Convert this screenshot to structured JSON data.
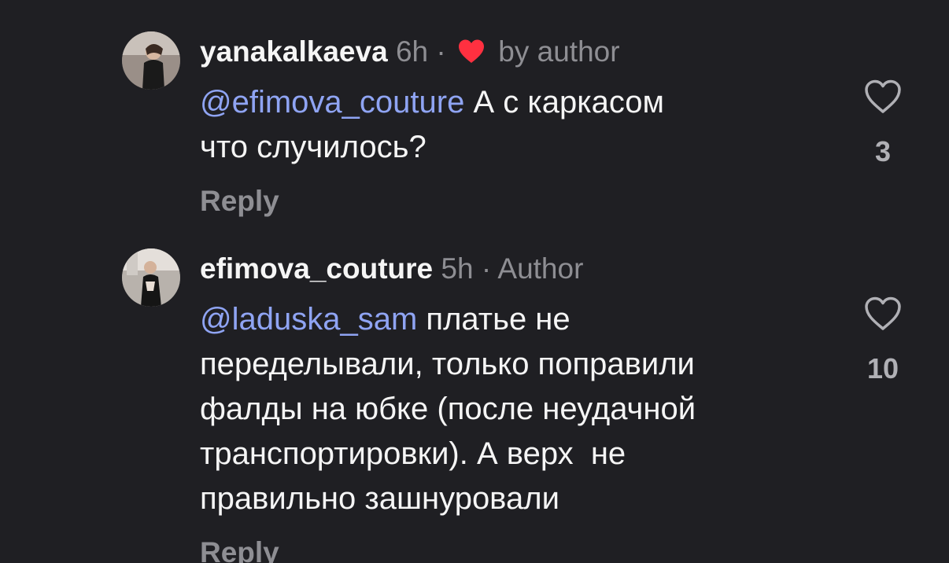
{
  "comments": [
    {
      "username": "yanakalkaeva",
      "time": "6h",
      "separator": "·",
      "liked_by_author_label": "by author",
      "mention": "@efimova_couture",
      "text": " А с каркасом\nчто случилось?",
      "reply_label": "Reply",
      "like_count": "3",
      "heart_color": "#ff3040"
    },
    {
      "username": "efimova_couture",
      "time": "5h",
      "separator": "·",
      "author_label": "Author",
      "mention": "@laduska_sam",
      "text": " платье не\nпеределывали, только поправили\nфалды на юбке (после неудачной\nтранспортировки). А верх  не\nправильно зашнуровали",
      "reply_label": "Reply",
      "like_count": "10"
    }
  ]
}
